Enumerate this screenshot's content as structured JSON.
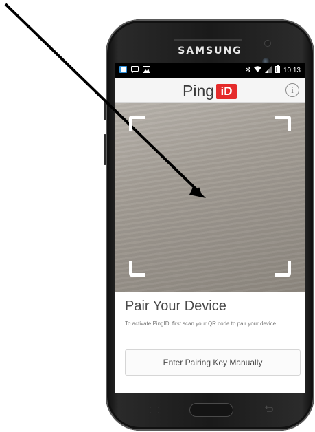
{
  "phone": {
    "brand": "SAMSUNG"
  },
  "status_bar": {
    "left_icons": [
      "app-notification-icon",
      "message-icon",
      "image-icon"
    ],
    "right_icons": [
      "bluetooth-icon",
      "wifi-icon",
      "signal-icon",
      "battery-icon"
    ],
    "time": "10:13"
  },
  "header": {
    "logo_text": "Ping",
    "logo_box_text": "iD",
    "info_label": "i"
  },
  "scanner": {
    "corner_icons": [
      "scan-corner-top-left",
      "scan-corner-top-right",
      "scan-corner-bottom-left",
      "scan-corner-bottom-right"
    ]
  },
  "pairing": {
    "title": "Pair Your Device",
    "description": "To activate PingID, first scan your QR code to pair your device.",
    "manual_button_label": "Enter Pairing Key Manually"
  },
  "annotation": {
    "arrow_color": "#000000"
  },
  "colors": {
    "brand_red": "#e52b2b",
    "header_bg": "#f5f5f5",
    "status_bar_bg": "#000000"
  }
}
